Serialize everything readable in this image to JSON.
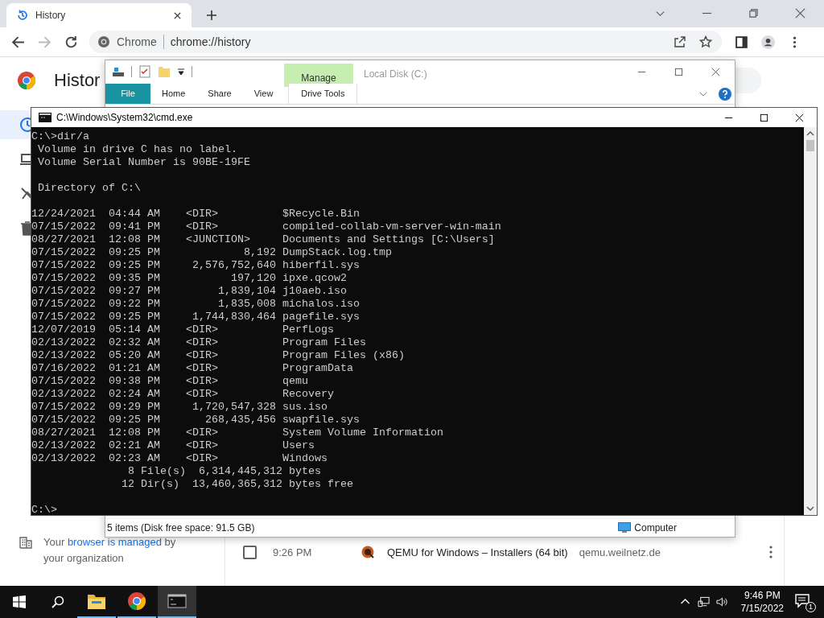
{
  "browser": {
    "tab": {
      "title": "History"
    },
    "omnibox": {
      "site_label": "Chrome",
      "url": "chrome://history"
    },
    "page": {
      "title": "Histor",
      "sidebar_items": [
        {
          "kind": "history",
          "selected": true
        },
        {
          "kind": "tabs",
          "selected": false
        },
        {
          "kind": "clear",
          "selected": false
        },
        {
          "kind": "trash",
          "selected": false
        }
      ],
      "managed_note": {
        "before": "Your",
        "link": "browser is managed",
        "after": "by your organization"
      },
      "history_rows": [
        {
          "time": "9:26 PM",
          "title": "QEMU for Windows – Installers (64 bit)",
          "domain": "qemu.weilnetz.de",
          "checked": false
        }
      ]
    }
  },
  "explorer": {
    "title": "Local Disk (C:)",
    "context_tab": "Manage",
    "ribbon_tabs": [
      {
        "label": "File",
        "kind": "file"
      },
      {
        "label": "Home",
        "kind": "tab"
      },
      {
        "label": "Share",
        "kind": "tab"
      },
      {
        "label": "View",
        "kind": "tab"
      },
      {
        "label": "Drive Tools",
        "kind": "context"
      }
    ],
    "status": "5 items (Disk free space: 91.5 GB)",
    "location": "Computer"
  },
  "console": {
    "title": "C:\\Windows\\System32\\cmd.exe",
    "blocks": [
      {
        "lines": [
          "C:\\>dir/a",
          " Volume in drive C has no label.",
          " Volume Serial Number is 90BE-19FE"
        ]
      },
      {
        "lines": [
          " Directory of C:\\"
        ]
      },
      {
        "lines": [
          "12/24/2021  04:44 AM    <DIR>          $Recycle.Bin",
          "07/15/2022  09:41 PM    <DIR>          compiled-collab-vm-server-win-main",
          "08/27/2021  12:08 PM    <JUNCTION>     Documents and Settings [C:\\Users]",
          "07/15/2022  09:25 PM             8,192 DumpStack.log.tmp",
          "07/15/2022  09:25 PM     2,576,752,640 hiberfil.sys",
          "07/15/2022  09:35 PM           197,120 ipxe.qcow2",
          "07/15/2022  09:27 PM         1,839,104 j10aeb.iso",
          "07/15/2022  09:22 PM         1,835,008 michalos.iso",
          "07/15/2022  09:25 PM     1,744,830,464 pagefile.sys",
          "12/07/2019  05:14 AM    <DIR>          PerfLogs",
          "02/13/2022  02:32 AM    <DIR>          Program Files",
          "02/13/2022  05:20 AM    <DIR>          Program Files (x86)",
          "07/16/2022  01:21 AM    <DIR>          ProgramData",
          "07/15/2022  09:38 PM    <DIR>          qemu",
          "02/13/2022  02:24 AM    <DIR>          Recovery",
          "07/15/2022  09:29 PM     1,720,547,328 sus.iso",
          "07/15/2022  09:25 PM       268,435,456 swapfile.sys",
          "08/27/2021  12:08 PM    <DIR>          System Volume Information",
          "02/13/2022  02:21 AM    <DIR>          Users",
          "02/13/2022  02:23 AM    <DIR>          Windows",
          "               8 File(s)  6,314,445,312 bytes",
          "              12 Dir(s)  13,460,365,312 bytes free"
        ]
      },
      {
        "lines": [
          "C:\\>"
        ]
      }
    ]
  },
  "taskbar": {
    "apps": [
      {
        "kind": "explorer",
        "active": false
      },
      {
        "kind": "chrome",
        "active": false
      },
      {
        "kind": "cmd",
        "active": true
      }
    ],
    "time": "9:46 PM",
    "date": "7/15/2022",
    "notifications": "1"
  }
}
